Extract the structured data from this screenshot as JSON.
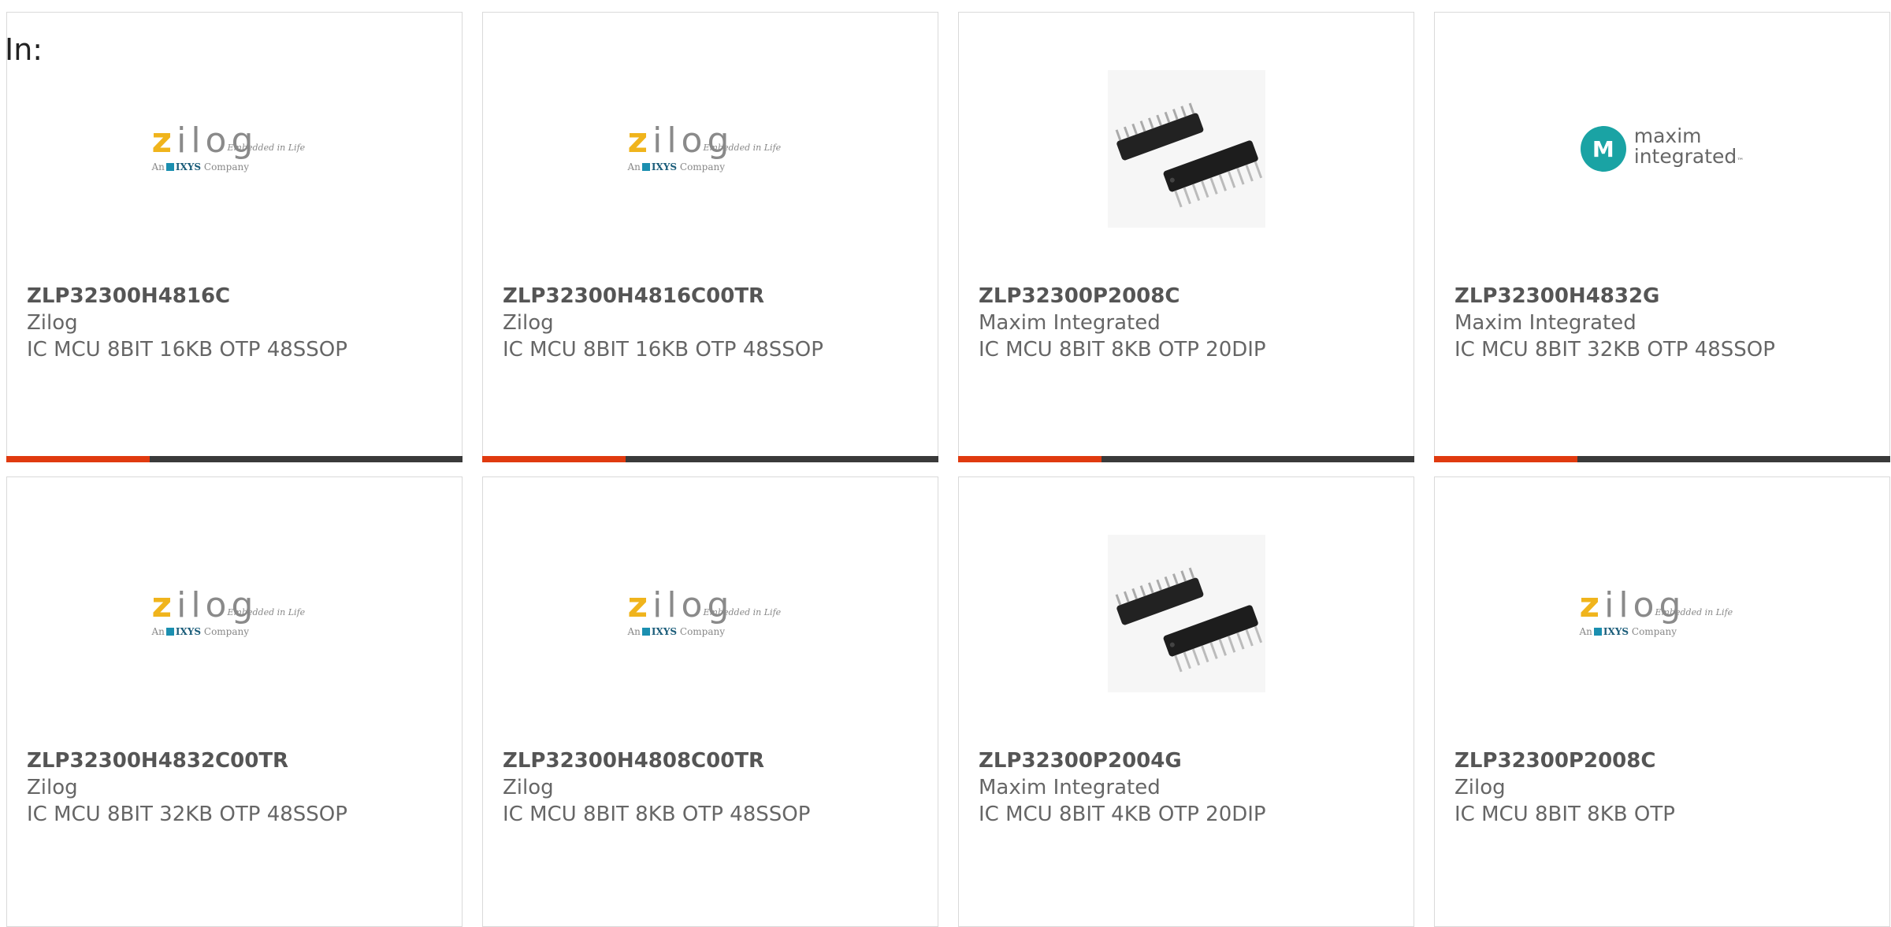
{
  "filter_label": "In:",
  "colors": {
    "accent": "#e03a0f",
    "bar": "#3a3a3a",
    "maxim_teal": "#1aa3a4",
    "zilog_yellow": "#f0b41c"
  },
  "logos": {
    "zilog": {
      "word": "ilog",
      "letter": "z",
      "tagline": "Embedded in Life",
      "sub_prefix": "An",
      "sub_name": "IXYS",
      "sub_suffix": "Company"
    },
    "maxim": {
      "symbol": "M",
      "line1": "maxim",
      "line2": "integrated",
      "tm": "™"
    }
  },
  "products": [
    {
      "part": "ZLP32300H4816C",
      "manufacturer": "Zilog",
      "description": "IC MCU 8BIT 16KB OTP 48SSOP",
      "image": "zilog-logo"
    },
    {
      "part": "ZLP32300H4816C00TR",
      "manufacturer": "Zilog",
      "description": "IC MCU 8BIT 16KB OTP 48SSOP",
      "image": "zilog-logo"
    },
    {
      "part": "ZLP32300P2008C",
      "manufacturer": "Maxim Integrated",
      "description": "IC MCU 8BIT 8KB OTP 20DIP",
      "image": "chip-photo"
    },
    {
      "part": "ZLP32300H4832G",
      "manufacturer": "Maxim Integrated",
      "description": "IC MCU 8BIT 32KB OTP 48SSOP",
      "image": "maxim-logo"
    },
    {
      "part": "ZLP32300H4832C00TR",
      "manufacturer": "Zilog",
      "description": "IC MCU 8BIT 32KB OTP 48SSOP",
      "image": "zilog-logo"
    },
    {
      "part": "ZLP32300H4808C00TR",
      "manufacturer": "Zilog",
      "description": "IC MCU 8BIT 8KB OTP 48SSOP",
      "image": "zilog-logo"
    },
    {
      "part": "ZLP32300P2004G",
      "manufacturer": "Maxim Integrated",
      "description": "IC MCU 8BIT 4KB OTP 20DIP",
      "image": "chip-photo"
    },
    {
      "part": "ZLP32300P2008C",
      "manufacturer": "Zilog",
      "description": "IC MCU 8BIT 8KB OTP",
      "image": "zilog-logo"
    }
  ]
}
